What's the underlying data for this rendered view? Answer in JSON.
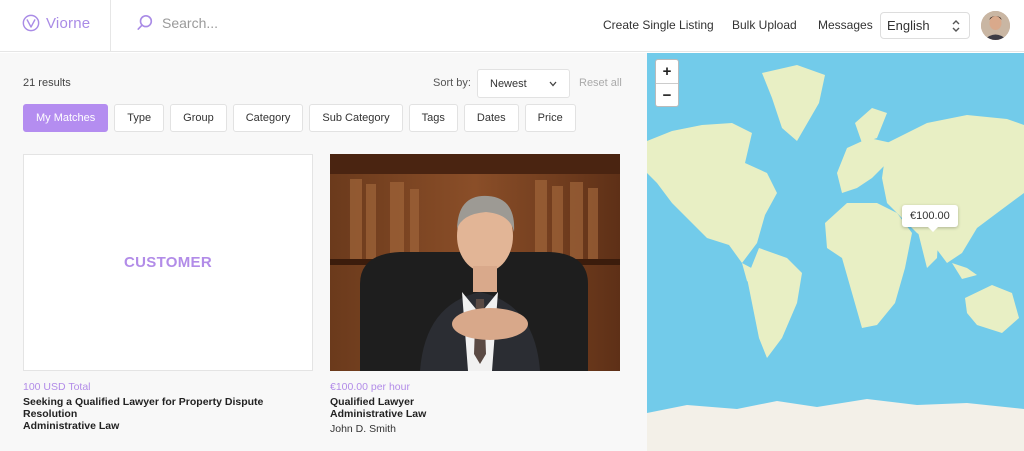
{
  "brand": {
    "name": "Viorne",
    "color": "#a98be6"
  },
  "search": {
    "placeholder": "Search..."
  },
  "nav": {
    "create_listing": "Create Single Listing",
    "bulk_upload": "Bulk Upload",
    "messages": "Messages",
    "language": "English"
  },
  "listing": {
    "results": "21 results",
    "sort_label": "Sort by:",
    "sort_value": "Newest",
    "reset": "Reset all",
    "filters": [
      "My Matches",
      "Type",
      "Group",
      "Category",
      "Sub Category",
      "Tags",
      "Dates",
      "Price"
    ]
  },
  "cards": [
    {
      "image_label": "CUSTOMER",
      "price": "100 USD Total",
      "title": "Seeking a Qualified Lawyer for Property Dispute Resolution",
      "subtitle": "Administrative Law",
      "author": ""
    },
    {
      "image_label": "",
      "price": "€100.00 per hour",
      "title": "Qualified Lawyer",
      "subtitle": "Administrative Law",
      "author": "John D. Smith"
    }
  ],
  "map": {
    "zoom_in": "+",
    "zoom_out": "−",
    "marker": "€100.00",
    "ocean_color": "#72cbea",
    "land_color": "#e8efc4"
  },
  "colors": {
    "accent": "#b48df0"
  }
}
